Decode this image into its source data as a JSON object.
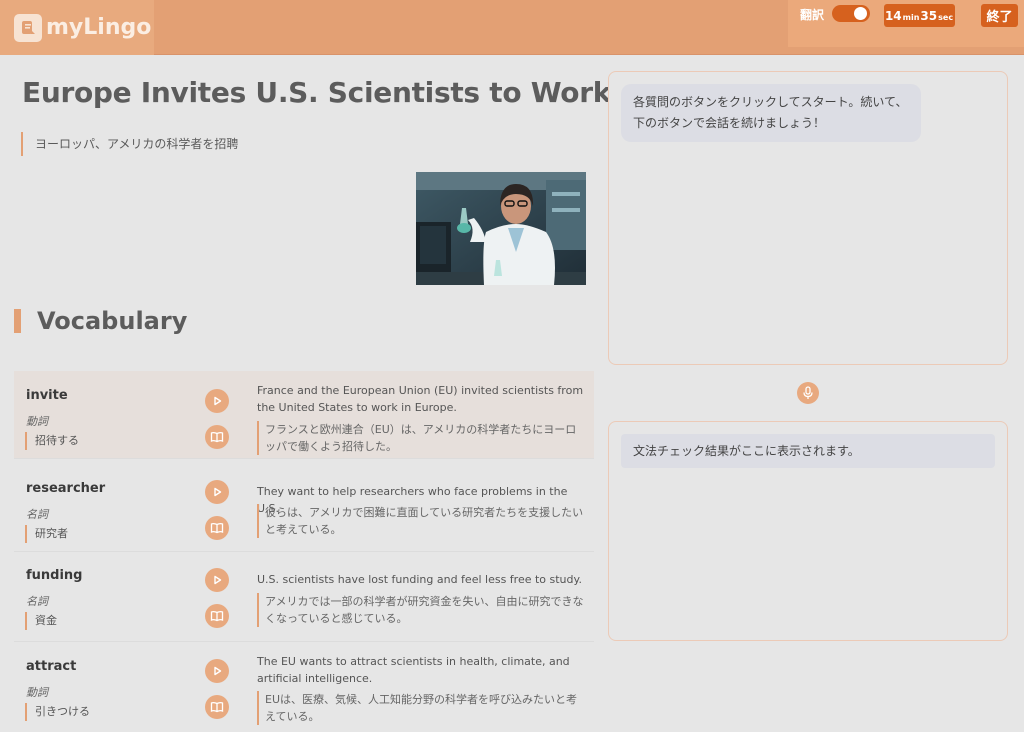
{
  "header": {
    "app_name": "myLingo",
    "translate_label": "翻訳",
    "translate_on": true,
    "timer": {
      "minutes": "14",
      "min_unit": "min",
      "seconds": "35",
      "sec_unit": "sec"
    },
    "end_label": "終了",
    "accent_color": "#d6611e",
    "header_color": "#e3a074"
  },
  "article": {
    "title": "Europe Invites U.S. Scientists to Work",
    "subtitle": "ヨーロッパ、アメリカの科学者を招聘"
  },
  "vocab": {
    "heading": "Vocabulary",
    "items": [
      {
        "word": "invite",
        "pos": "動詞",
        "meaning": "招待する",
        "example": "France and the European Union (EU) invited scientists from the United States to work in Europe.",
        "example_ja": "フランスと欧州連合（EU）は、アメリカの科学者たちにヨーロッパで働くよう招待した。"
      },
      {
        "word": "researcher",
        "pos": "名詞",
        "meaning": "研究者",
        "example": "They want to help researchers who face problems in the U.S.",
        "example_ja": "彼らは、アメリカで困難に直面している研究者たちを支援したいと考えている。"
      },
      {
        "word": "funding",
        "pos": "名詞",
        "meaning": "資金",
        "example": "U.S. scientists have lost funding and feel less free to study.",
        "example_ja": "アメリカでは一部の科学者が研究資金を失い、自由に研究できなくなっていると感じている。"
      },
      {
        "word": "attract",
        "pos": "動詞",
        "meaning": "引きつける",
        "example": "The EU wants to attract scientists in health, climate, and artificial intelligence.",
        "example_ja": "EUは、医療、気候、人工知能分野の科学者を呼び込みたいと考えている。"
      }
    ]
  },
  "chat": {
    "message": "各質問のボタンをクリックしてスタート。続いて、下のボタンで会話を続けましょう！"
  },
  "grammar": {
    "placeholder": "文法チェック結果がここに表示されます。"
  }
}
